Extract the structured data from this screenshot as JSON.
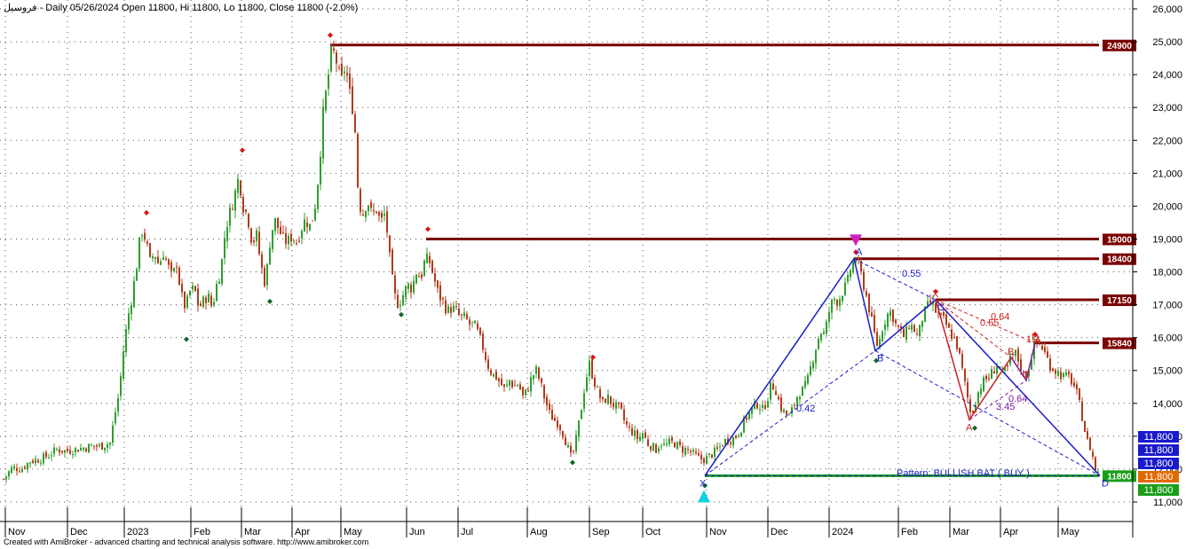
{
  "header": {
    "symbol": "فروسيل",
    "info": " - Daily 05/26/2024 Open 11800, Hi 11800, Lo 11800, Close 11800 (-2.0%)"
  },
  "footer": "Created with AmiBroker - advanced charting and technical analysis software. http://www.amibroker.com",
  "colors": {
    "up": "#2e9e2e",
    "down": "#b03a1a",
    "level": "#7a0000",
    "support": "#1a9e1a",
    "harmonic": "#1a1acc",
    "pattern_red": "#cc2020",
    "pattern_purple": "#7a1a9e"
  },
  "chart_data": {
    "type": "candlestick",
    "ylim": [
      10200,
      26300
    ],
    "y_ticks": [
      11000,
      12000,
      13000,
      14000,
      15000,
      16000,
      17000,
      18000,
      19000,
      20000,
      21000,
      22000,
      23000,
      24000,
      25000,
      26000
    ],
    "y_tick_labels": [
      "11,000",
      "12,000",
      "13,000",
      "14,000",
      "15,000",
      "16,000",
      "17,000",
      "18,000",
      "19,000",
      "20,000",
      "21,000",
      "22,000",
      "23,000",
      "24,000",
      "25,000",
      "26,000"
    ],
    "x_labels": [
      "Nov",
      "Dec",
      "2023",
      "Feb",
      "Mar",
      "Apr",
      "May",
      "Jun",
      "Jul",
      "Aug",
      "Sep",
      "Oct",
      "Nov",
      "Dec",
      "2024",
      "Feb",
      "Mar",
      "Apr",
      "May"
    ],
    "price_path": [
      [
        0,
        11700
      ],
      [
        10,
        12050
      ],
      [
        20,
        12000
      ],
      [
        30,
        12250
      ],
      [
        40,
        12300
      ],
      [
        50,
        12400
      ],
      [
        60,
        12600
      ],
      [
        70,
        12550
      ],
      [
        80,
        12600
      ],
      [
        90,
        12650
      ],
      [
        100,
        12700
      ],
      [
        110,
        12700
      ],
      [
        120,
        12800
      ],
      [
        125,
        13600
      ],
      [
        130,
        14300
      ],
      [
        135,
        15600
      ],
      [
        140,
        16600
      ],
      [
        145,
        17300
      ],
      [
        150,
        18200
      ],
      [
        155,
        19300
      ],
      [
        160,
        19000
      ],
      [
        165,
        18300
      ],
      [
        170,
        18600
      ],
      [
        175,
        18200
      ],
      [
        180,
        18600
      ],
      [
        185,
        18200
      ],
      [
        190,
        17800
      ],
      [
        195,
        18300
      ],
      [
        200,
        17300
      ],
      [
        205,
        16900
      ],
      [
        210,
        17400
      ],
      [
        215,
        17500
      ],
      [
        220,
        16900
      ],
      [
        225,
        17100
      ],
      [
        230,
        17300
      ],
      [
        235,
        16900
      ],
      [
        240,
        17600
      ],
      [
        245,
        18100
      ],
      [
        250,
        19300
      ],
      [
        255,
        19800
      ],
      [
        260,
        20300
      ],
      [
        265,
        20900
      ],
      [
        270,
        20000
      ],
      [
        275,
        19700
      ],
      [
        280,
        18900
      ],
      [
        285,
        19100
      ],
      [
        290,
        18200
      ],
      [
        295,
        17600
      ],
      [
        300,
        18900
      ],
      [
        305,
        19600
      ],
      [
        310,
        19300
      ],
      [
        315,
        19000
      ],
      [
        320,
        18900
      ],
      [
        325,
        19100
      ],
      [
        330,
        18900
      ],
      [
        335,
        19300
      ],
      [
        340,
        19600
      ],
      [
        345,
        19400
      ],
      [
        350,
        19800
      ],
      [
        355,
        21000
      ],
      [
        360,
        22800
      ],
      [
        365,
        23800
      ],
      [
        370,
        24800
      ],
      [
        375,
        24400
      ],
      [
        380,
        23700
      ],
      [
        385,
        24300
      ],
      [
        390,
        23400
      ],
      [
        395,
        22800
      ],
      [
        400,
        20100
      ],
      [
        405,
        19800
      ],
      [
        410,
        20200
      ],
      [
        415,
        19700
      ],
      [
        420,
        19900
      ],
      [
        425,
        19500
      ],
      [
        430,
        19800
      ],
      [
        435,
        18400
      ],
      [
        440,
        17300
      ],
      [
        445,
        17000
      ],
      [
        450,
        17300
      ],
      [
        455,
        17600
      ],
      [
        460,
        17500
      ],
      [
        465,
        18000
      ],
      [
        470,
        17800
      ],
      [
        475,
        18400
      ],
      [
        480,
        18300
      ],
      [
        485,
        17800
      ],
      [
        490,
        17300
      ],
      [
        495,
        17100
      ],
      [
        500,
        16800
      ],
      [
        505,
        16900
      ],
      [
        510,
        16800
      ],
      [
        515,
        16600
      ],
      [
        520,
        16600
      ],
      [
        525,
        16400
      ],
      [
        530,
        16400
      ],
      [
        535,
        16100
      ],
      [
        540,
        15700
      ],
      [
        545,
        15200
      ],
      [
        550,
        14900
      ],
      [
        555,
        14800
      ],
      [
        560,
        14600
      ],
      [
        565,
        14400
      ],
      [
        570,
        14700
      ],
      [
        575,
        14500
      ],
      [
        580,
        14600
      ],
      [
        585,
        14200
      ],
      [
        590,
        14400
      ],
      [
        595,
        14800
      ],
      [
        600,
        15000
      ],
      [
        605,
        14600
      ],
      [
        610,
        14100
      ],
      [
        615,
        13700
      ],
      [
        620,
        13500
      ],
      [
        625,
        13400
      ],
      [
        630,
        13100
      ],
      [
        635,
        12700
      ],
      [
        640,
        12300
      ],
      [
        645,
        12900
      ],
      [
        650,
        13700
      ],
      [
        655,
        14600
      ],
      [
        660,
        15200
      ],
      [
        665,
        14700
      ],
      [
        670,
        14300
      ],
      [
        675,
        14000
      ],
      [
        680,
        14200
      ],
      [
        685,
        14000
      ],
      [
        690,
        13900
      ],
      [
        695,
        13800
      ],
      [
        700,
        13400
      ],
      [
        705,
        13200
      ],
      [
        710,
        13100
      ],
      [
        715,
        12900
      ],
      [
        720,
        13100
      ],
      [
        725,
        12800
      ],
      [
        730,
        12700
      ],
      [
        735,
        12600
      ],
      [
        740,
        12800
      ],
      [
        745,
        12700
      ],
      [
        750,
        12800
      ],
      [
        755,
        12800
      ],
      [
        760,
        12700
      ],
      [
        765,
        12600
      ],
      [
        770,
        12600
      ],
      [
        775,
        12500
      ],
      [
        780,
        12400
      ],
      [
        785,
        12300
      ],
      [
        790,
        12300
      ],
      [
        795,
        12400
      ],
      [
        800,
        12500
      ],
      [
        805,
        12600
      ],
      [
        810,
        12800
      ],
      [
        815,
        12900
      ],
      [
        820,
        12900
      ],
      [
        825,
        13000
      ],
      [
        830,
        13200
      ],
      [
        835,
        13500
      ],
      [
        840,
        13700
      ],
      [
        845,
        13900
      ],
      [
        850,
        14000
      ],
      [
        855,
        13800
      ],
      [
        860,
        14100
      ],
      [
        865,
        14600
      ],
      [
        870,
        14400
      ],
      [
        875,
        13900
      ],
      [
        880,
        13700
      ],
      [
        885,
        13600
      ],
      [
        890,
        13900
      ],
      [
        895,
        14300
      ],
      [
        900,
        14400
      ],
      [
        905,
        14600
      ],
      [
        910,
        15200
      ],
      [
        915,
        15700
      ],
      [
        920,
        16200
      ],
      [
        925,
        16100
      ],
      [
        930,
        16800
      ],
      [
        935,
        17200
      ],
      [
        940,
        17100
      ],
      [
        945,
        17400
      ],
      [
        950,
        17600
      ],
      [
        955,
        18200
      ],
      [
        960,
        18400
      ],
      [
        965,
        18000
      ],
      [
        970,
        17500
      ],
      [
        975,
        16900
      ],
      [
        980,
        16200
      ],
      [
        985,
        15700
      ],
      [
        990,
        16300
      ],
      [
        995,
        16700
      ],
      [
        1000,
        16800
      ],
      [
        1005,
        16400
      ],
      [
        1010,
        16200
      ],
      [
        1015,
        16000
      ],
      [
        1020,
        16400
      ],
      [
        1025,
        16300
      ],
      [
        1030,
        16000
      ],
      [
        1035,
        16600
      ],
      [
        1040,
        16900
      ],
      [
        1045,
        17100
      ],
      [
        1050,
        16800
      ],
      [
        1055,
        16600
      ],
      [
        1060,
        16500
      ],
      [
        1065,
        16200
      ],
      [
        1070,
        16000
      ],
      [
        1075,
        15700
      ],
      [
        1080,
        15000
      ],
      [
        1085,
        14300
      ],
      [
        1090,
        13600
      ],
      [
        1095,
        14100
      ],
      [
        1100,
        14500
      ],
      [
        1105,
        14700
      ],
      [
        1110,
        14800
      ],
      [
        1115,
        15000
      ],
      [
        1120,
        15200
      ],
      [
        1125,
        14900
      ],
      [
        1130,
        15000
      ],
      [
        1135,
        15400
      ],
      [
        1140,
        15500
      ],
      [
        1145,
        15200
      ],
      [
        1150,
        14800
      ],
      [
        1155,
        15100
      ],
      [
        1160,
        15700
      ],
      [
        1165,
        15900
      ],
      [
        1170,
        15700
      ],
      [
        1175,
        15400
      ],
      [
        1180,
        15100
      ],
      [
        1185,
        15000
      ],
      [
        1190,
        14900
      ],
      [
        1195,
        14800
      ],
      [
        1200,
        14800
      ],
      [
        1205,
        14600
      ],
      [
        1210,
        14200
      ],
      [
        1215,
        13600
      ],
      [
        1220,
        12900
      ],
      [
        1225,
        12600
      ],
      [
        1230,
        12000
      ],
      [
        1235,
        11800
      ]
    ],
    "resistance_levels": [
      {
        "label": "24900",
        "value": 24900,
        "x_start": 368
      },
      {
        "label": "19000",
        "value": 19000,
        "x_start": 476
      },
      {
        "label": "18400",
        "value": 18400,
        "x_start": 958
      },
      {
        "label": "17150",
        "value": 17150,
        "x_start": 1050
      },
      {
        "label": "15840",
        "value": 15840,
        "x_start": 1162
      }
    ],
    "support_level": {
      "label": "11800",
      "value": 11800,
      "x_start": 790
    },
    "right_axis_price_tags": [
      {
        "label": "11,800",
        "color": "#1a1acc"
      },
      {
        "label": "11,800",
        "color": "#1a1acc"
      },
      {
        "label": "11,800",
        "color": "#1a1acc"
      },
      {
        "label": "11,800",
        "color": "#e06a00"
      },
      {
        "label": "11,800",
        "color": "#1a9e1a"
      }
    ],
    "harmonic_bat": {
      "pattern_label": "Pattern: BULLISH BAT ( BUY )",
      "points": {
        "X": {
          "label": "X",
          "x": 790,
          "y": 11800
        },
        "A": {
          "label": "A",
          "x": 958,
          "y": 18400
        },
        "B": {
          "label": "B",
          "x": 982,
          "y": 15600
        },
        "C": {
          "label": "C",
          "x": 1050,
          "y": 17150
        },
        "D": {
          "label": "D",
          "x": 1235,
          "y": 11800
        }
      },
      "ratios": [
        {
          "label": "0.55",
          "x": 1012,
          "y": 17850,
          "color": "#1a1acc"
        },
        {
          "label": "0.42",
          "x": 893,
          "y": 13750,
          "color": "#1a1acc"
        }
      ]
    },
    "inner_pattern": {
      "points": {
        "X": {
          "label": "X",
          "x": 1050,
          "y": 17150
        },
        "A": {
          "label": "A",
          "x": 1088,
          "y": 13500
        },
        "B": {
          "label": "B",
          "x": 1135,
          "y": 15400
        },
        "C": {
          "label": "C",
          "x": 1152,
          "y": 14700
        },
        "D": {
          "label": "D",
          "x": 1162,
          "y": 15840
        }
      },
      "ratios": [
        {
          "label": "0.64",
          "x": 1112,
          "y": 16550,
          "color": "#cc2020"
        },
        {
          "label": "0.55",
          "x": 1100,
          "y": 16350,
          "color": "#cc2020"
        },
        {
          "label": "0.64",
          "x": 1132,
          "y": 14050,
          "color": "#7a1a9e"
        },
        {
          "label": "3.45",
          "x": 1118,
          "y": 13800,
          "color": "#7a1a9e"
        },
        {
          "label": "1.3",
          "x": 1152,
          "y": 15850,
          "color": "#cc2020"
        }
      ]
    },
    "peak_markers": [
      {
        "x": 161,
        "y": 19800
      },
      {
        "x": 269,
        "y": 21700
      },
      {
        "x": 368,
        "y": 25200
      },
      {
        "x": 478,
        "y": 19300
      },
      {
        "x": 664,
        "y": 15400
      },
      {
        "x": 960,
        "y": 18600
      },
      {
        "x": 1050,
        "y": 17400
      },
      {
        "x": 1162,
        "y": 16100
      }
    ],
    "trough_markers": [
      {
        "x": 206,
        "y": 15950
      },
      {
        "x": 300,
        "y": 17100
      },
      {
        "x": 448,
        "y": 16700
      },
      {
        "x": 641,
        "y": 12200
      },
      {
        "x": 790,
        "y": 11500
      },
      {
        "x": 983,
        "y": 15300
      },
      {
        "x": 1094,
        "y": 13250
      }
    ],
    "signals": [
      {
        "type": "sell",
        "x": 960,
        "y": 18950
      },
      {
        "type": "buy",
        "x": 789,
        "y": 11150
      }
    ]
  }
}
